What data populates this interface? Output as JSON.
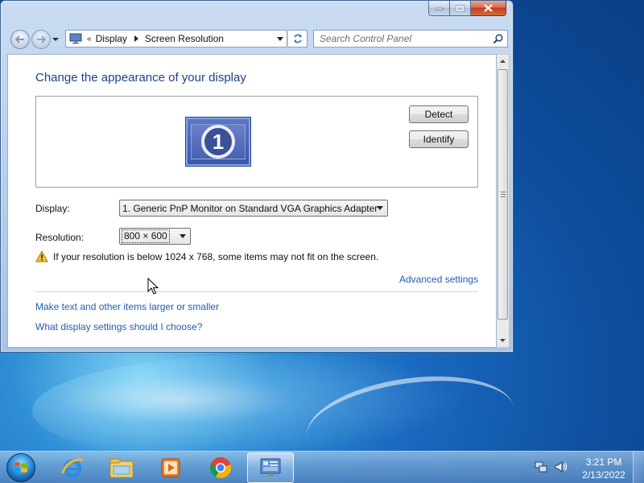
{
  "window": {
    "address": {
      "crumbs": [
        "Display",
        "Screen Resolution"
      ],
      "overflow_glyph": "«"
    },
    "search": {
      "placeholder": "Search Control Panel"
    },
    "controls": [
      "minimize-icon",
      "maximize-icon",
      "close-icon"
    ]
  },
  "content": {
    "title": "Change the appearance of your display",
    "monitor_number": "1",
    "detect_label": "Detect",
    "identify_label": "Identify",
    "display_label": "Display:",
    "display_value": "1. Generic PnP Monitor on Standard VGA Graphics Adapter",
    "resolution_label": "Resolution:",
    "resolution_value": "800 × 600",
    "warning_text": "If your resolution is below 1024 x 768, some items may not fit on the screen.",
    "advanced_link": "Advanced settings",
    "link_text_size": "Make text and other items larger or smaller",
    "link_what_settings": "What display settings should I choose?"
  },
  "taskbar": {
    "pinned": [
      "internet-explorer-icon",
      "windows-explorer-icon",
      "media-player-icon",
      "chrome-icon",
      "control-panel-icon"
    ],
    "active": "control-panel-icon",
    "clock": {
      "time": "3:21 PM",
      "date": "2/13/2022"
    }
  },
  "colors": {
    "title_blue": "#1e3f8c",
    "link_blue": "#1f5db5",
    "window_frame": "#b5cde9",
    "desktop": "#1a6ac0"
  }
}
